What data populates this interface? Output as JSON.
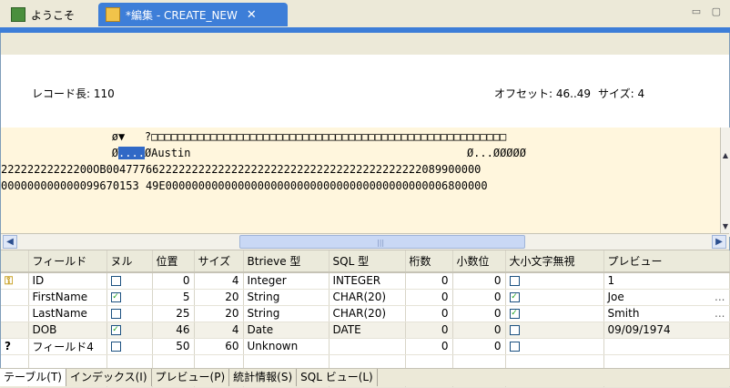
{
  "tabs": [
    {
      "label": "ようこそ",
      "active": false
    },
    {
      "label": "*編集 - CREATE_NEW",
      "active": true
    }
  ],
  "info": {
    "record_length": "レコード長: 110",
    "offset": "オフセット: 46..49",
    "size": "サイズ: 4"
  },
  "hex": {
    "line0": "        ø▼   ?□□□□□□□□□□□□□□□□□□□□□□□□□□□□□□□□□□□□□□□□□□□□□□□□□□□□□□",
    "line1a": "        Ø",
    "line1sel": "....",
    "line1b": "ØAustin                                          Ø...ØØØØØ",
    "line2": "22222222222200OB004777662222222222222222222222222222222222222222089900000",
    "line3": "000000000000099670153 49E0000000000000000000000000000000000000000006800000"
  },
  "grid": {
    "headers": [
      "",
      "フィールド",
      "ヌル",
      "位置",
      "サイズ",
      "Btrieve 型",
      "SQL 型",
      "桁数",
      "小数位",
      "大小文字無視",
      "プレビュー"
    ],
    "rows": [
      {
        "marker": "key",
        "field": "ID",
        "null": false,
        "pos": "0",
        "size": "4",
        "btype": "Integer",
        "sqltype": "INTEGER",
        "digits": "0",
        "decimals": "0",
        "case": false,
        "preview": "1",
        "more": ""
      },
      {
        "marker": "",
        "field": "FirstName",
        "null": true,
        "pos": "5",
        "size": "20",
        "btype": "String",
        "sqltype": "CHAR(20)",
        "digits": "0",
        "decimals": "0",
        "case": true,
        "preview": "Joe",
        "more": "..."
      },
      {
        "marker": "",
        "field": "LastName",
        "null": false,
        "pos": "25",
        "size": "20",
        "btype": "String",
        "sqltype": "CHAR(20)",
        "digits": "0",
        "decimals": "0",
        "case": true,
        "preview": "Smith",
        "more": "..."
      },
      {
        "marker": "",
        "field": "DOB",
        "null": true,
        "pos": "46",
        "size": "4",
        "btype": "Date",
        "sqltype": "DATE",
        "digits": "0",
        "decimals": "0",
        "case": false,
        "preview": "09/09/1974",
        "more": ""
      },
      {
        "marker": "?",
        "field": "フィールド4",
        "null": false,
        "pos": "50",
        "size": "60",
        "btype": "Unknown",
        "sqltype": "",
        "digits": "0",
        "decimals": "0",
        "case": false,
        "preview": "",
        "more": ""
      }
    ]
  },
  "bottom_tabs": [
    {
      "label": "テーブル(T)",
      "active": true
    },
    {
      "label": "インデックス(I)",
      "active": false
    },
    {
      "label": "プレビュー(P)",
      "active": false
    },
    {
      "label": "統計情報(S)",
      "active": false
    },
    {
      "label": "SQL ビュー(L)",
      "active": false
    }
  ]
}
